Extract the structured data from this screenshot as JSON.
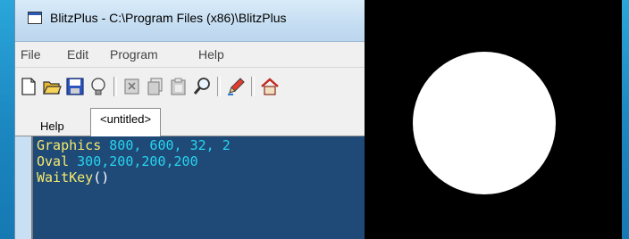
{
  "window": {
    "title": "BlitzPlus - C:\\Program Files (x86)\\BlitzPlus"
  },
  "menu": [
    {
      "label": "File"
    },
    {
      "label": "Edit"
    },
    {
      "label": "Program"
    },
    {
      "label": "Help"
    }
  ],
  "toolbar": [
    {
      "icon": "new-file-icon"
    },
    {
      "icon": "open-folder-icon"
    },
    {
      "icon": "save-disk-icon"
    },
    {
      "icon": "lightbulb-icon"
    },
    {
      "icon": "cut-icon"
    },
    {
      "icon": "copy-icon"
    },
    {
      "icon": "paste-icon"
    },
    {
      "icon": "find-magnifier-icon"
    },
    {
      "icon": "run-pencil-icon"
    },
    {
      "icon": "home-icon"
    }
  ],
  "tabs": [
    {
      "label": "Help",
      "active": false
    },
    {
      "label": "<untitled>",
      "active": true
    }
  ],
  "code": [
    [
      {
        "t": "Graphics",
        "c": "kw"
      },
      {
        "t": " 800, 600, 32, 2",
        "c": "num"
      }
    ],
    [
      {
        "t": "Oval",
        "c": "kw"
      },
      {
        "t": " 300,200,200,200",
        "c": "num"
      }
    ],
    [
      {
        "t": "WaitKey",
        "c": "kw"
      },
      {
        "t": "()",
        "c": "plain"
      }
    ]
  ],
  "colors": {
    "editor_bg": "#1f4a78",
    "keyword": "#f5e96a",
    "number": "#28d3ee",
    "output_bg": "#000000",
    "oval_fill": "#ffffff"
  }
}
